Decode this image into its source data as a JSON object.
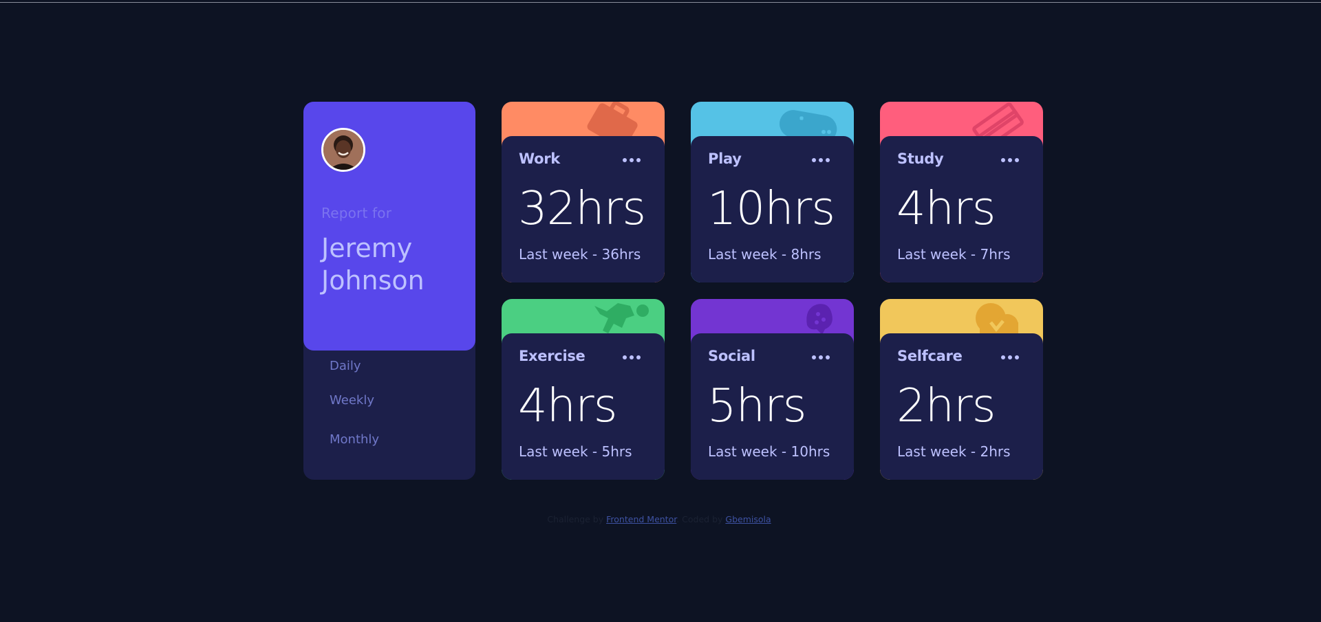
{
  "profile": {
    "report_for": "Report for",
    "name": "Jeremy Johnson",
    "periods": [
      {
        "label": "Daily"
      },
      {
        "label": "Weekly"
      },
      {
        "label": "Monthly"
      }
    ]
  },
  "cards": [
    {
      "title": "Work",
      "current": "32hrs",
      "previous": "Last week - 36hrs",
      "color": "#ff8b64",
      "icon": "briefcase-icon"
    },
    {
      "title": "Play",
      "current": "10hrs",
      "previous": "Last week - 8hrs",
      "color": "#55c2e6",
      "icon": "gamepad-icon"
    },
    {
      "title": "Study",
      "current": "4hrs",
      "previous": "Last week - 7hrs",
      "color": "#ff5e7d",
      "icon": "books-icon"
    },
    {
      "title": "Exercise",
      "current": "4hrs",
      "previous": "Last week - 5hrs",
      "color": "#4bcf82",
      "icon": "runner-icon"
    },
    {
      "title": "Social",
      "current": "5hrs",
      "previous": "Last week - 10hrs",
      "color": "#7335d2",
      "icon": "chat-bubble-icon"
    },
    {
      "title": "Selfcare",
      "current": "2hrs",
      "previous": "Last week - 2hrs",
      "color": "#f1c75b",
      "icon": "heart-icon"
    }
  ],
  "footer": {
    "challenge_by": "Challenge by",
    "frontend_mentor": "Frontend Mentor",
    "coded_by": ". Coded by",
    "author": "Gbemisola"
  }
}
